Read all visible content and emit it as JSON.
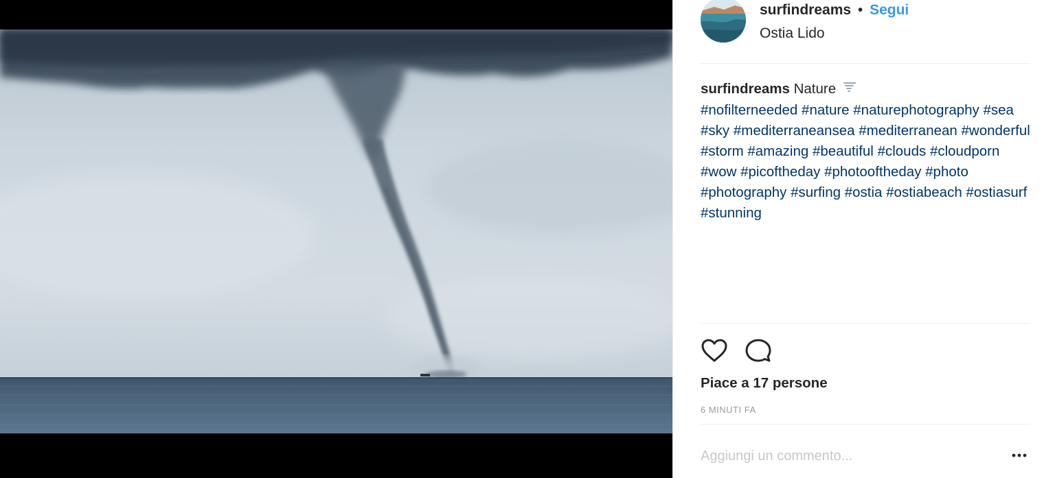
{
  "post": {
    "username": "surfindreams",
    "separator": "•",
    "follow_label": "Segui",
    "location": "Ostia Lido",
    "photo_subject": "waterspout over the sea",
    "caption": {
      "username": "surfindreams",
      "text": "Nature",
      "emoji_icon": "tornado-icon",
      "hashtags": [
        "#nofilterneeded",
        "#nature",
        "#naturephotography",
        "#sea",
        "#sky",
        "#mediterraneansea",
        "#mediterranean",
        "#wonderful",
        "#storm",
        "#amazing",
        "#beautiful",
        "#clouds",
        "#cloudporn",
        "#wow",
        "#picoftheday",
        "#photooftheday",
        "#photo",
        "#photography",
        "#surfing",
        "#ostia",
        "#ostiabeach",
        "#ostiasurf",
        "#stunning"
      ]
    },
    "actions": {
      "like_icon": "heart-icon",
      "comment_icon": "comment-bubble-icon"
    },
    "likes_text": "Piace a 17 persone",
    "timestamp": "6 MINUTI FA",
    "comment_placeholder": "Aggiungi un commento...",
    "more_icon": "more-options-icon"
  },
  "colors": {
    "link": "#3897f0",
    "hashtag": "#003569",
    "text": "#262626",
    "muted": "#999999",
    "placeholder": "#c7c7c7",
    "divider": "#efefef"
  }
}
